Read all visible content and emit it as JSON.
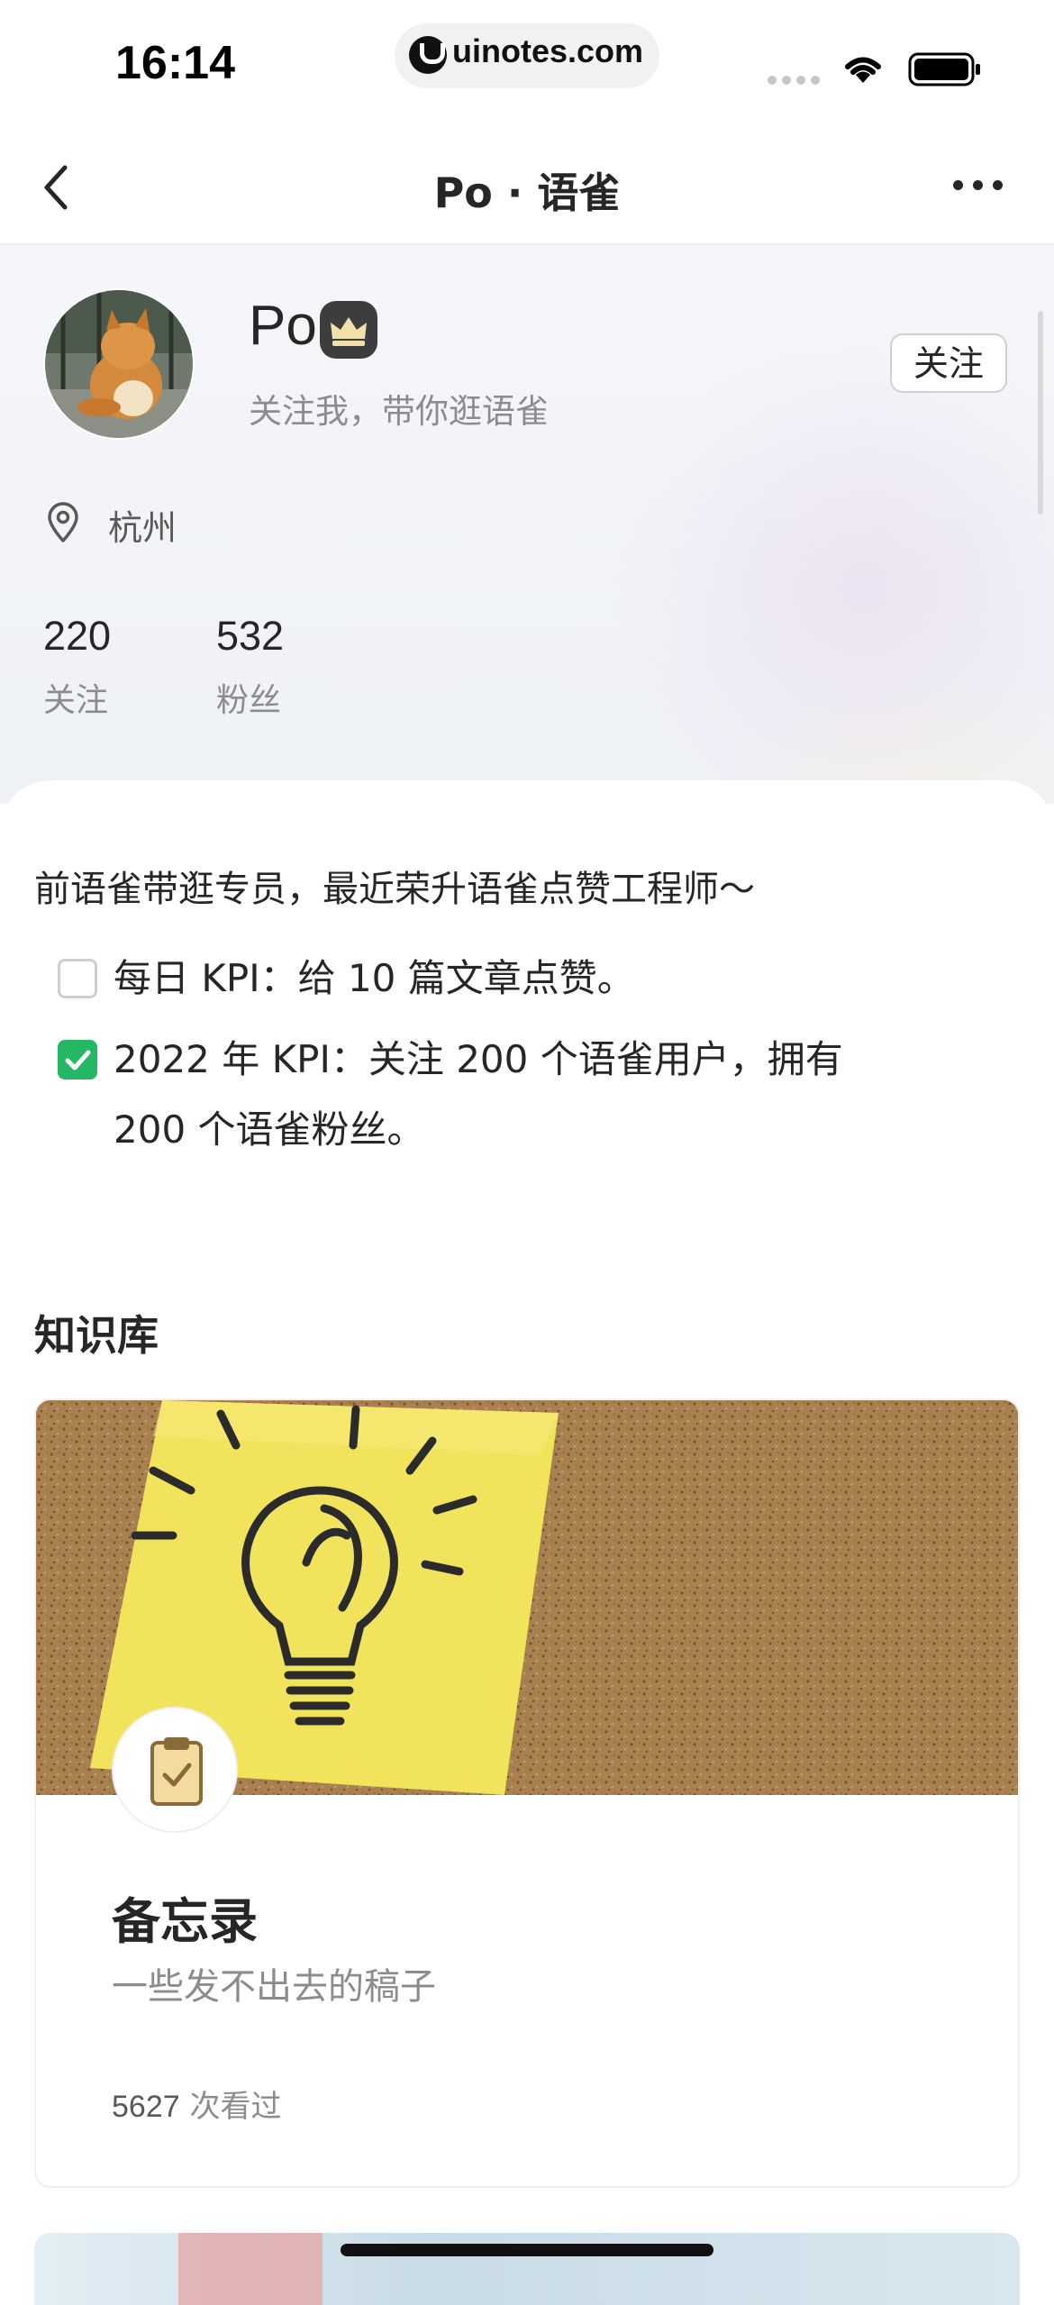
{
  "status_bar": {
    "time": "16:14",
    "url": "uinotes.com"
  },
  "nav": {
    "title": "Po · 语雀"
  },
  "profile": {
    "name": "Po",
    "tagline": "关注我，带你逛语雀",
    "follow_label": "关注",
    "location": "杭州",
    "stats": [
      {
        "value": "220",
        "label": "关注"
      },
      {
        "value": "532",
        "label": "粉丝"
      }
    ]
  },
  "bio": {
    "text": "前语雀带逛专员，最近荣升语雀点赞工程师～",
    "todos": [
      {
        "checked": false,
        "lines": [
          "每日 KPI：给 10 篇文章点赞。"
        ]
      },
      {
        "checked": true,
        "lines": [
          "2022 年 KPI：关注 200 个语雀用户，拥有",
          "200 个语雀粉丝。"
        ]
      }
    ]
  },
  "knowledge": {
    "section_title": "知识库",
    "books": [
      {
        "title": "备忘录",
        "description": "一些发不出去的稿子",
        "view_count": "5627",
        "view_suffix": " 次看过"
      }
    ]
  },
  "colors": {
    "accent_green": "#25b864",
    "text_primary": "#262626",
    "text_secondary": "#8c8c8c"
  }
}
